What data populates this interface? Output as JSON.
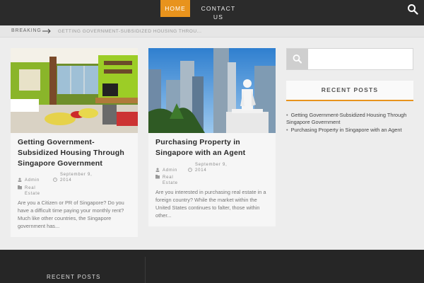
{
  "nav": {
    "home_label": "HOME",
    "contact_label": "CONTACT US",
    "accent_color": "#e8931d"
  },
  "breaking": {
    "label": "BREAKING",
    "headline": "GETTING GOVERNMENT-SUBSIDIZED HOUSING THROU..."
  },
  "posts": [
    {
      "title": "Getting Government-Subsidized Housing Through Singapore Government",
      "date": "September 9, 2014",
      "author": "Admin",
      "category": "Real Estate",
      "excerpt": "Are you a Citizen or PR of Singapore? Do you have a difficult time paying your monthly rent? Much like other countries, the Singapore government has...",
      "image": "apartment-interior-photo"
    },
    {
      "title": "Purchasing Property in Singapore with an Agent",
      "date": "September 9, 2014",
      "author": "Admin",
      "category": "Real Estate",
      "excerpt": "Are you interested in purchasing real estate in a foreign country? While the market within the United States continues to falter, those within other...",
      "image": "singapore-skyline-statue-photo"
    }
  ],
  "sidebar": {
    "search_placeholder": "",
    "recent_title": "RECENT POSTS",
    "recent_posts": [
      "Getting Government-Subsidized Housing Through Singapore Government",
      "Purchasing Property in Singapore with an Agent"
    ]
  },
  "footer": {
    "recent_title": "RECENT POSTS"
  }
}
